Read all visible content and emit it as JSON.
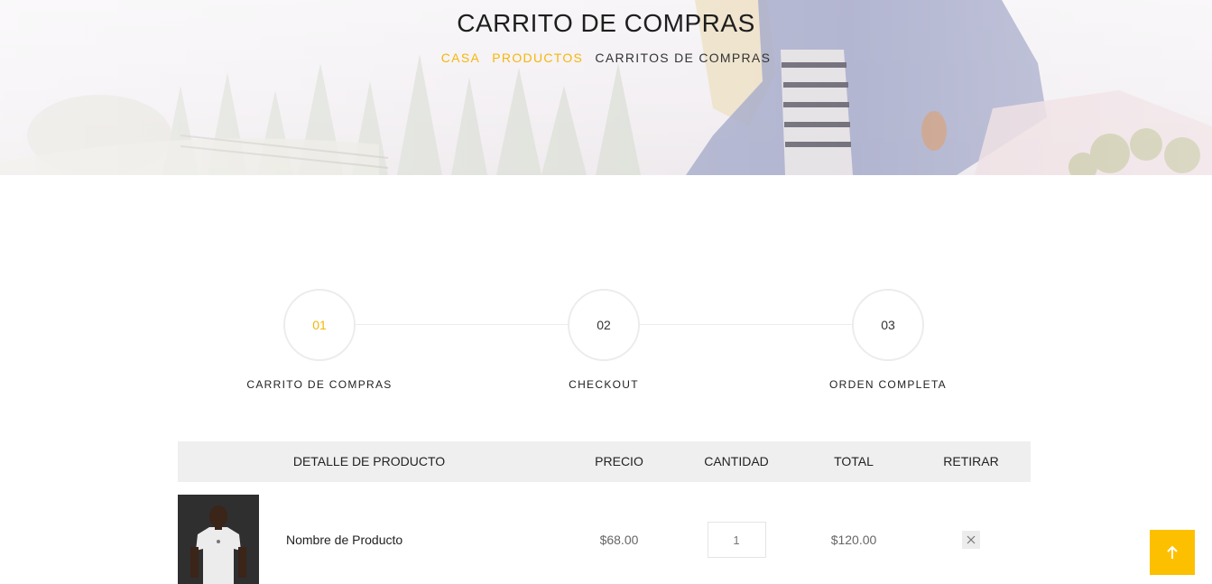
{
  "hero": {
    "title": "CARRITO DE COMPRAS",
    "breadcrumb": [
      {
        "label": "CASA",
        "link": true
      },
      {
        "label": "PRODUCTOS",
        "link": true
      },
      {
        "label": "CARRITOS DE COMPRAS",
        "link": false
      }
    ]
  },
  "steps": [
    {
      "number": "01",
      "label": "CARRITO DE COMPRAS",
      "active": true
    },
    {
      "number": "02",
      "label": "CHECKOUT",
      "active": false
    },
    {
      "number": "03",
      "label": "ORDEN COMPLETA",
      "active": false
    }
  ],
  "cart": {
    "headers": {
      "product": "DETALLE DE PRODUCTO",
      "price": "PRECIO",
      "quantity": "CANTIDAD",
      "total": "TOTAL",
      "remove": "RETIRAR"
    },
    "items": [
      {
        "name": "Nombre de Producto",
        "price": "$68.00",
        "quantity": "1",
        "total": "$120.00"
      }
    ]
  },
  "icons": {
    "remove": "close-icon",
    "back_to_top": "arrow-up-icon"
  },
  "colors": {
    "accent": "#f5b70a",
    "back_to_top_bg": "#fdc000",
    "table_header_bg": "#efefef"
  }
}
